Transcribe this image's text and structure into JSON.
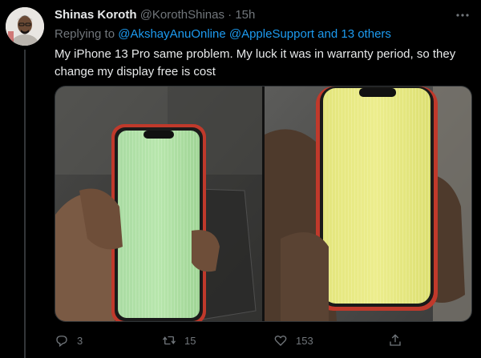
{
  "tweet": {
    "author": {
      "display_name": "Shinas Koroth",
      "handle": "@KorothShinas",
      "separator": "·",
      "time": "15h"
    },
    "reply": {
      "prefix": "Replying to ",
      "mention1": "@AkshayAnuOnline",
      "mention2": "@AppleSupport",
      "suffix_link": "and 13 others"
    },
    "text": "My iPhone 13 Pro same problem. My luck it was in warranty period, so they change my display free is cost",
    "media": [
      {
        "description_icon": "photo-green-screen-iphone"
      },
      {
        "description_icon": "photo-yellow-screen-iphone"
      }
    ],
    "actions": {
      "replies": "3",
      "retweets": "15",
      "likes": "153"
    }
  },
  "colors": {
    "background": "#000000",
    "text": "#e7e9ea",
    "muted": "#71767b",
    "accent": "#1d9bf0",
    "divider": "#333639"
  }
}
